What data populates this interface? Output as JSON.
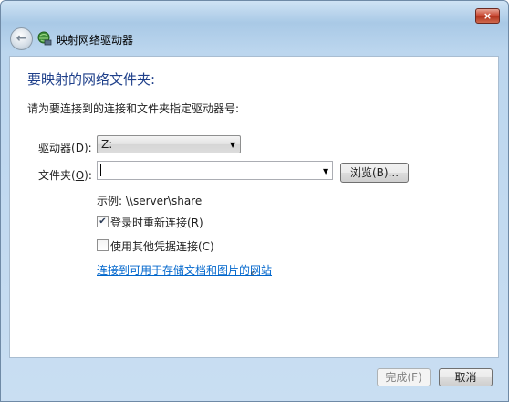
{
  "window": {
    "title": "映射网络驱动器",
    "close_glyph": "×",
    "back_glyph": "←"
  },
  "main": {
    "heading": "要映射的网络文件夹:",
    "instruction": "请为要连接到的连接和文件夹指定驱动器号:"
  },
  "drive": {
    "label_prefix": "驱动器(",
    "label_key": "D",
    "label_suffix": "):",
    "selected": "Z:"
  },
  "folder": {
    "label_prefix": "文件夹(",
    "label_key": "O",
    "label_suffix": "):",
    "value": "",
    "browse_label": "浏览(B)..."
  },
  "example_text": "示例: \\\\server\\share",
  "options": {
    "reconnect_label": "登录时重新连接(R)",
    "reconnect_checked": true,
    "credentials_label": "使用其他凭据连接(C)",
    "credentials_checked": false
  },
  "link_text": "连接到可用于存储文档和图片的网站",
  "link_suffix": "。",
  "footer": {
    "finish_label": "完成(F)",
    "cancel_label": "取消"
  },
  "colors": {
    "heading": "#1e3f8a",
    "link": "#0066cc",
    "close_button": "#c7422c"
  },
  "icons": {
    "check": "✔",
    "dropdown": "▼"
  }
}
